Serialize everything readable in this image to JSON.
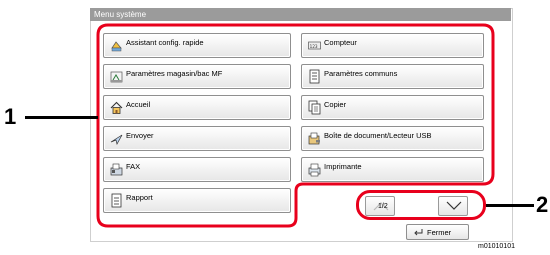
{
  "window": {
    "title": "Menu système"
  },
  "menu_items": [
    {
      "label": "Assistant config. rapide",
      "icon": "quick-setup-wizard-icon"
    },
    {
      "label": "Compteur",
      "icon": "counter-icon"
    },
    {
      "label": "Paramètres magasin/bac MF",
      "icon": "cassette-mp-tray-icon"
    },
    {
      "label": "Paramètres communs",
      "icon": "common-settings-icon"
    },
    {
      "label": "Accueil",
      "icon": "home-icon"
    },
    {
      "label": "Copier",
      "icon": "copy-icon"
    },
    {
      "label": "Envoyer",
      "icon": "send-icon"
    },
    {
      "label": "Boîte de document/Lecteur USB",
      "icon": "document-box-usb-icon"
    },
    {
      "label": "FAX",
      "icon": "fax-icon"
    },
    {
      "label": "Imprimante",
      "icon": "printer-icon"
    },
    {
      "label": "Rapport",
      "icon": "report-icon"
    }
  ],
  "pagination": {
    "page": "1/2",
    "up_icon": "chevron-up-icon",
    "down_icon": "chevron-down-icon"
  },
  "close_button": {
    "label": "Fermer",
    "icon": "return-arrow-icon"
  },
  "callouts": {
    "one": "1",
    "two": "2"
  },
  "reference_code": "m01010101",
  "colors": {
    "highlight": "#e8001c",
    "titlebar": "#9b9b9b"
  }
}
